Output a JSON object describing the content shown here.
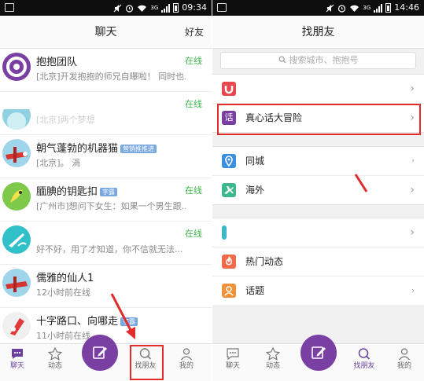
{
  "left": {
    "status": {
      "net": "3G",
      "time": "09:34"
    },
    "header": {
      "title": "聊天",
      "right_action": "好友"
    },
    "chats": [
      {
        "name": "抱抱团队",
        "message": "[北京]开发抱抱的师兄自曝啦！ 同时也...",
        "status": "在线",
        "tag": ""
      },
      {
        "name": "",
        "message": "[北京]两个梦想",
        "status": "在线",
        "tag": ""
      },
      {
        "name": "朝气蓬勃的机器猫",
        "message": "[北京]。 渦",
        "status": "",
        "tag": "营销推推进"
      },
      {
        "name": "腼腆的钥匙扣",
        "message": "[广州市]想问下女生：如果一个男生跟...",
        "status": "在线",
        "tag": "字露"
      },
      {
        "name": "",
        "message": "好不好，用了才知道，你不信就无法...",
        "status": "在线",
        "tag": ""
      },
      {
        "name": "儒雅的仙人1",
        "message": "12小时前在线",
        "status": "",
        "tag": ""
      },
      {
        "name": "十字路口、向哪走",
        "message": "11小时前在线",
        "status": "",
        "tag": "字露"
      }
    ],
    "tabs": [
      {
        "label": "聊天",
        "icon": "chat-bubble-icon"
      },
      {
        "label": "动态",
        "icon": "star-icon"
      },
      {
        "label": "",
        "icon": "compose-icon"
      },
      {
        "label": "找朋友",
        "icon": "search-icon"
      },
      {
        "label": "我的",
        "icon": "person-icon"
      }
    ]
  },
  "right": {
    "status": {
      "net": "3G",
      "time": "14:46"
    },
    "header": {
      "title": "找朋友"
    },
    "search": {
      "placeholder": "搜索城市、抱抱号"
    },
    "rows": [
      {
        "label": "",
        "icon_color": "#e8474f",
        "icon": "magnet-icon"
      },
      {
        "label": "真心话大冒险",
        "icon_color": "#7a3fa2",
        "icon": "truth-dare-icon",
        "icon_text": "话"
      },
      {
        "label": "同城",
        "icon_color": "#3b8fe0",
        "icon": "location-pin-icon"
      },
      {
        "label": "海外",
        "icon_color": "#3cb88a",
        "icon": "airplane-icon"
      },
      {
        "label": "",
        "icon_color": "#3cb8c4",
        "icon": "teal-icon"
      },
      {
        "label": "热门动态",
        "icon_color": "#f06a4c",
        "icon": "flame-icon"
      },
      {
        "label": "话题",
        "icon_color": "#f0923a",
        "icon": "topic-icon"
      }
    ],
    "tabs": [
      {
        "label": "聊天",
        "icon": "chat-bubble-icon"
      },
      {
        "label": "动态",
        "icon": "star-icon"
      },
      {
        "label": "",
        "icon": "compose-icon"
      },
      {
        "label": "找朋友",
        "icon": "search-icon"
      },
      {
        "label": "我的",
        "icon": "person-icon"
      }
    ]
  },
  "colors": {
    "accent": "#7a3fa2",
    "online": "#3bb54a",
    "highlight": "#e22b2b"
  }
}
